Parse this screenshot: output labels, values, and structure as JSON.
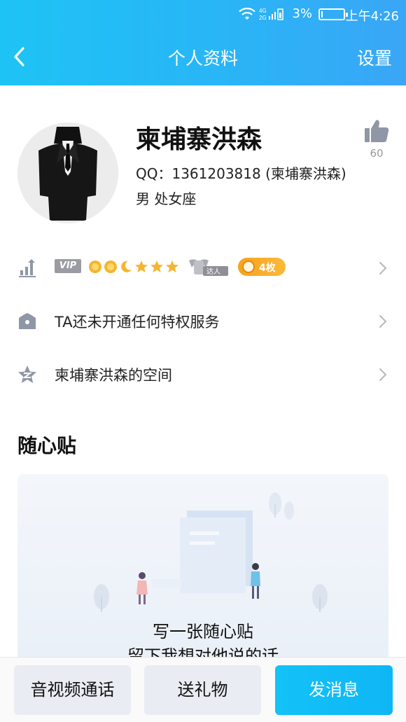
{
  "status_bar": {
    "network": "4G 2G",
    "battery_percent": "3%",
    "time": "上午4:26"
  },
  "nav": {
    "title": "个人资料",
    "settings_label": "设置",
    "back_icon": "back-chevron-icon"
  },
  "profile": {
    "name": "柬埔寨洪森",
    "qq": "QQ：1361203818 (柬埔寨洪森)",
    "gender_zodiac": "男  处女座",
    "like_count": "60"
  },
  "level_row": {
    "vip_label": "VIP",
    "daren_label": "达人",
    "coin_label": "4枚"
  },
  "privilege_row": {
    "text": "TA还未开通任何特权服务"
  },
  "space_row": {
    "text": "柬埔寨洪森的空间"
  },
  "notes": {
    "title": "随心贴",
    "line1": "写一张随心贴",
    "line2": "留下我想对他说的话"
  },
  "actions": {
    "call_label": "音视频通话",
    "gift_label": "送礼物",
    "message_label": "发消息"
  },
  "colors": {
    "header_start": "#1ec3f5",
    "header_end": "#3aa6f6",
    "accent": "#13c2f7",
    "coin_orange": "#f7a21d"
  }
}
